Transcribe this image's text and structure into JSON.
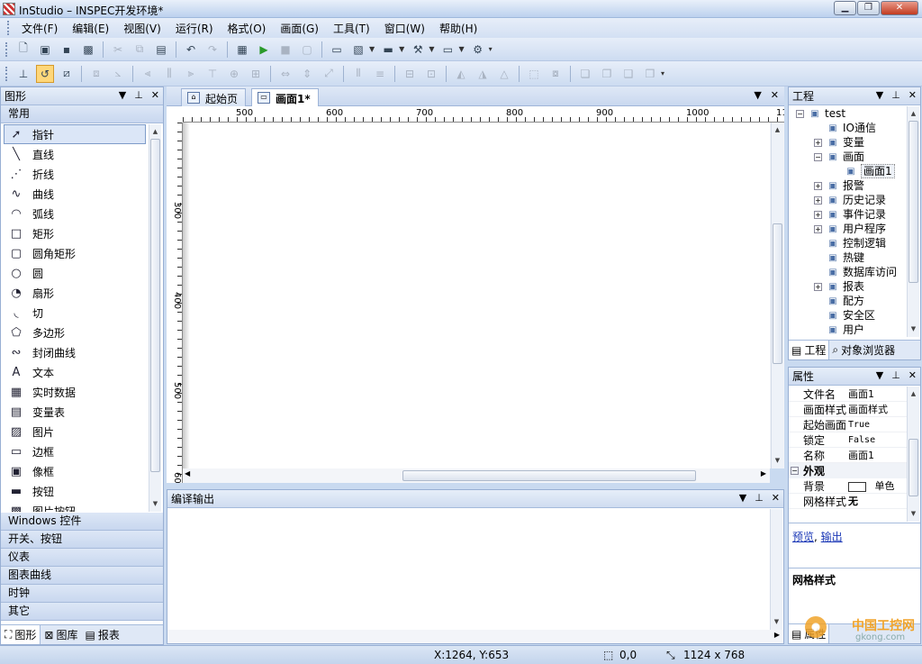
{
  "window": {
    "title": "InStudio – INSPEC开发环境*"
  },
  "menu": [
    "文件(F)",
    "编辑(E)",
    "视图(V)",
    "运行(R)",
    "格式(O)",
    "画面(G)",
    "工具(T)",
    "窗口(W)",
    "帮助(H)"
  ],
  "left_panel": {
    "title": "图形",
    "group_common": "常用",
    "tools": [
      {
        "label": "指针",
        "icon": "pointer-icon",
        "glyph": "➚"
      },
      {
        "label": "直线",
        "icon": "line-icon",
        "glyph": "╲"
      },
      {
        "label": "折线",
        "icon": "polyline-icon",
        "glyph": "⋰"
      },
      {
        "label": "曲线",
        "icon": "curve-icon",
        "glyph": "∿"
      },
      {
        "label": "弧线",
        "icon": "arc-icon",
        "glyph": "◠"
      },
      {
        "label": "矩形",
        "icon": "rectangle-icon",
        "glyph": "□"
      },
      {
        "label": "圆角矩形",
        "icon": "rounded-rectangle-icon",
        "glyph": "▢"
      },
      {
        "label": "圆",
        "icon": "circle-icon",
        "glyph": "○"
      },
      {
        "label": "扇形",
        "icon": "sector-icon",
        "glyph": "◔"
      },
      {
        "label": "切",
        "icon": "chord-icon",
        "glyph": "◟"
      },
      {
        "label": "多边形",
        "icon": "polygon-icon",
        "glyph": "⬠"
      },
      {
        "label": "封闭曲线",
        "icon": "closed-curve-icon",
        "glyph": "∾"
      },
      {
        "label": "文本",
        "icon": "text-icon",
        "glyph": "A"
      },
      {
        "label": "实时数据",
        "icon": "realtime-data-icon",
        "glyph": "▦"
      },
      {
        "label": "变量表",
        "icon": "variable-table-icon",
        "glyph": "▤"
      },
      {
        "label": "图片",
        "icon": "picture-icon",
        "glyph": "▨"
      },
      {
        "label": "边框",
        "icon": "border-icon",
        "glyph": "▭"
      },
      {
        "label": "像框",
        "icon": "frame-icon",
        "glyph": "▣"
      },
      {
        "label": "按钮",
        "icon": "button-icon",
        "glyph": "▬"
      },
      {
        "label": "图片按钮",
        "icon": "picture-button-icon",
        "glyph": "▩"
      }
    ],
    "groups": [
      "Windows 控件",
      "开关、按钮",
      "仪表",
      "图表曲线",
      "时钟",
      "其它"
    ],
    "tabs": [
      "图形",
      "图库",
      "报表"
    ]
  },
  "doc": {
    "tabs": [
      "起始页",
      "画面1*"
    ],
    "ruler_h": [
      "500",
      "600",
      "700",
      "800",
      "900",
      "1000",
      "11"
    ],
    "ruler_v": [
      "300",
      "400",
      "500",
      "60"
    ]
  },
  "output": {
    "title": "编译输出"
  },
  "project": {
    "title": "工程",
    "tree": [
      {
        "label": "test",
        "level": 0,
        "exp": "⊟",
        "icon": "project-icon"
      },
      {
        "label": "IO通信",
        "level": 1,
        "exp": "",
        "icon": "io-icon"
      },
      {
        "label": "变量",
        "level": 1,
        "exp": "⊞",
        "icon": "variable-icon"
      },
      {
        "label": "画面",
        "level": 1,
        "exp": "⊟",
        "icon": "screen-icon"
      },
      {
        "label": "画面1",
        "level": 2,
        "exp": "",
        "icon": "screen-item-icon"
      },
      {
        "label": "报警",
        "level": 1,
        "exp": "⊞",
        "icon": "alarm-icon"
      },
      {
        "label": "历史记录",
        "level": 1,
        "exp": "⊞",
        "icon": "history-icon"
      },
      {
        "label": "事件记录",
        "level": 1,
        "exp": "⊞",
        "icon": "event-icon"
      },
      {
        "label": "用户程序",
        "level": 1,
        "exp": "⊞",
        "icon": "user-program-icon"
      },
      {
        "label": "控制逻辑",
        "level": 1,
        "exp": "",
        "icon": "control-logic-icon"
      },
      {
        "label": "热键",
        "level": 1,
        "exp": "",
        "icon": "hotkey-icon"
      },
      {
        "label": "数据库访问",
        "level": 1,
        "exp": "",
        "icon": "database-icon"
      },
      {
        "label": "报表",
        "level": 1,
        "exp": "⊞",
        "icon": "report-icon"
      },
      {
        "label": "配方",
        "level": 1,
        "exp": "",
        "icon": "recipe-icon"
      },
      {
        "label": "安全区",
        "level": 1,
        "exp": "",
        "icon": "security-icon"
      },
      {
        "label": "用户",
        "level": 1,
        "exp": "",
        "icon": "user-icon"
      }
    ],
    "tabs": [
      "工程",
      "对象浏览器"
    ]
  },
  "properties": {
    "title": "属性",
    "rows": [
      {
        "k": "文件名",
        "v": "画面1",
        "mono": false
      },
      {
        "k": "画面样式",
        "v": "画面样式",
        "mono": false
      },
      {
        "k": "起始画面",
        "v": "True",
        "mono": true
      },
      {
        "k": "锁定",
        "v": "False",
        "mono": true
      },
      {
        "k": "名称",
        "v": "画面1",
        "mono": false
      }
    ],
    "category": "外观",
    "bg_label": "背景",
    "bg_value": "单色",
    "grid_label": "网格样式",
    "grid_value": "无",
    "link_preview": "预览",
    "link_sep": ",",
    "link_output": "输出",
    "desc": "网格样式",
    "tab": "属性"
  },
  "status": {
    "coords": "X:1264, Y:653",
    "position": "0,0",
    "size": "1124 x 768"
  },
  "watermark": {
    "line1": "中国工控网",
    "line2": "gkong.com"
  }
}
